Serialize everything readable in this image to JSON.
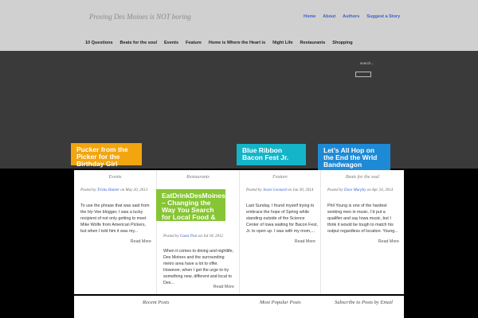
{
  "header": {
    "tagline": "Proving Des Moines is NOT boring",
    "top_nav": [
      "Home",
      "About",
      "Authors",
      "Suggest a Story"
    ],
    "main_nav": [
      "10 Questions",
      "Beats for the soul",
      "Events",
      "Feature",
      "Home is Where the Heart is",
      "Night Life",
      "Restaurants",
      "Shopping"
    ]
  },
  "search": {
    "label": "search..."
  },
  "features": {
    "yellow": "Pucker from the Picker for the Birthday Girl",
    "cyan": "Blue Ribbon Bacon Fest Jr.",
    "blue": "Let’s All Hop on the End the Wrld Bandwagon",
    "green": "EatDrinkDesMoines.com – Changing the Way You Search for Local Food & Drink"
  },
  "posts": [
    {
      "category": "Events",
      "posted_by": "Posted by",
      "author": "Trisha Hunter",
      "date": "on May 20, 2013",
      "excerpt": "To use the phrase that was said from the Hy-Vee blogger, I was a lucky recipient of not only getting to meet Mike Wolfe from American Pickers, but when I told him it was my...",
      "read_more": "Read More"
    },
    {
      "category": "Restaurants",
      "posted_by": "Posted by",
      "author": "Guest Post",
      "date": "on Jul 18, 2012",
      "excerpt": "When it comes to dining and nightlife, Des Moines and the surrounding metro area have a lot to offer. However, when I get the urge to try something new, different and local to Des...",
      "read_more": "Read More"
    },
    {
      "category": "Feature",
      "posted_by": "Posted by",
      "author": "Jessie Leonard",
      "date": "on Jan 30, 2014",
      "excerpt": "Last Sunday, I found myself trying to embrace the hope of Spring while standing outside of the Science Center of Iowa waiting for Bacon Fest, Jr. to open up.   I was with my mom,...",
      "read_more": "Read More"
    },
    {
      "category": "Beats for the soul",
      "posted_by": "Posted by",
      "author": "Dave Murphy",
      "date": "on Apr 24, 2014",
      "excerpt": "Phil Young is one of the hardest working men in music. I’d put a qualifier and say Iowa music, but I think it would be tough to match his output regardless of location. Young...",
      "read_more": "Read More"
    }
  ],
  "footer": {
    "recent": "Recent Posts",
    "popular": "Most Popular Posts",
    "subscribe": "Subscribe to Posts by Email"
  }
}
